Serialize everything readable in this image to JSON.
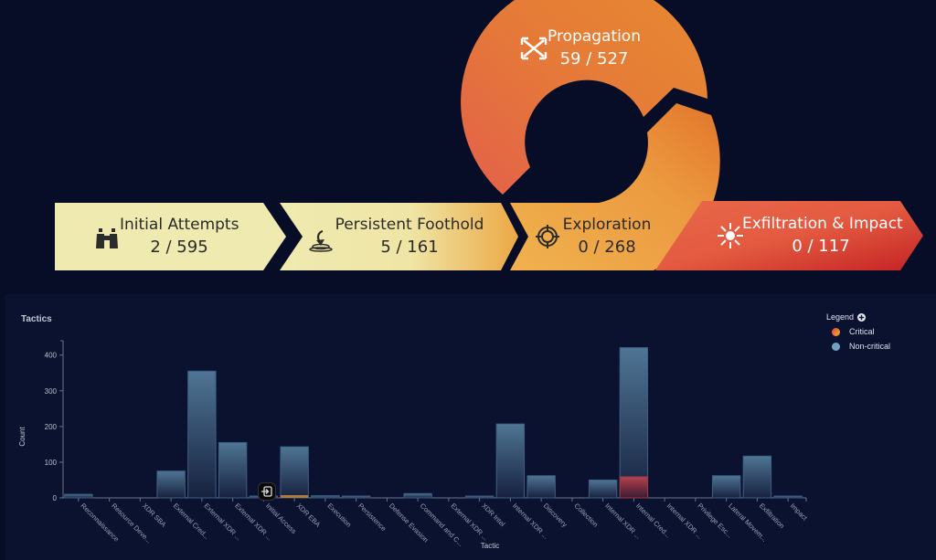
{
  "stages": [
    {
      "title": "Initial Attempts",
      "value": "2 / 595",
      "icon": "binoculars-icon"
    },
    {
      "title": "Persistent Foothold",
      "value": "5 / 161",
      "icon": "anchor-drop-icon"
    },
    {
      "title": "Exploration",
      "value": "0 / 268",
      "icon": "crosshair-icon"
    },
    {
      "title": "Propagation",
      "value": "59 / 527",
      "icon": "shuffle-arrows-icon"
    },
    {
      "title": "Exfiltration & Impact",
      "value": "0 / 117",
      "icon": "burst-icon"
    }
  ],
  "colors": {
    "background": "#070d26",
    "panel": "#0b1230",
    "stage_light": "#efeab0",
    "stage_orange": "#e88a3a",
    "stage_red": "#c62828",
    "bar_top": "#4f7594",
    "bar_bottom": "#16213f",
    "critical": "#a83a4a",
    "critical_low": "#b07a3a",
    "noncritical_legend": "#6fa3c4"
  },
  "legend": {
    "title": "Legend",
    "items": [
      {
        "label": "Critical"
      },
      {
        "label": "Non-critical"
      }
    ]
  },
  "chart_data": {
    "type": "bar",
    "title": "Tactics",
    "xlabel": "Tactic",
    "ylabel": "Count",
    "ylim": [
      0,
      430
    ],
    "yticks": [
      0,
      100,
      200,
      300,
      400
    ],
    "grid": false,
    "legend_position": "top-right",
    "categories": [
      "Reconnaissance",
      "Resource Deve...",
      "XDR SBA",
      "External Cred...",
      "External XDR ...",
      "External XDR ...",
      "Initial Access",
      "XDR EBA",
      "Execution",
      "Persistence",
      "Defense Evasion",
      "Command and C...",
      "External XDR ...",
      "XDR Intel",
      "Internal XDR ...",
      "Discovery",
      "Collection",
      "Internal XDR ...",
      "Internal Cred...",
      "Internal XDR ...",
      "Privilege Esc...",
      "Lateral Movem...",
      "Exfiltration",
      "Impact"
    ],
    "series": [
      {
        "name": "Non-critical",
        "values": [
          10,
          0,
          0,
          75,
          355,
          155,
          3,
          138,
          6,
          3,
          0,
          12,
          0,
          4,
          207,
          62,
          0,
          50,
          362,
          0,
          0,
          62,
          117,
          2
        ]
      },
      {
        "name": "Critical",
        "values": [
          0,
          0,
          0,
          0,
          0,
          0,
          0,
          5,
          0,
          0,
          0,
          0,
          0,
          0,
          0,
          0,
          0,
          0,
          59,
          0,
          0,
          0,
          0,
          0
        ]
      }
    ]
  }
}
